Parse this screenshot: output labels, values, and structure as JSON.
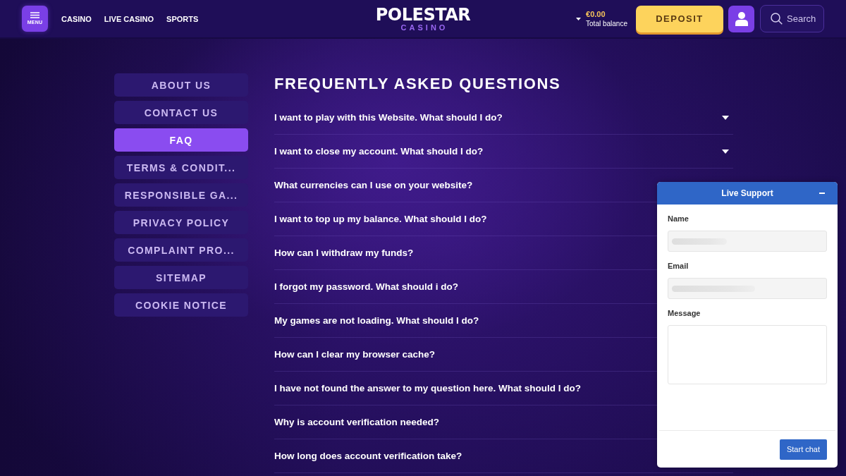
{
  "header": {
    "menu_button": {
      "label": "MENU"
    },
    "nav": [
      "CASINO",
      "LIVE CASINO",
      "SPORTS"
    ],
    "logo": {
      "title": "POLESTAR",
      "subtitle": "CASINO"
    },
    "balance": {
      "amount": "€0.00",
      "label": "Total balance"
    },
    "deposit_button": "DEPOSIT",
    "search": {
      "placeholder": "Search"
    }
  },
  "sidebar": {
    "items": [
      {
        "label": "ABOUT US",
        "selected": false
      },
      {
        "label": "CONTACT US",
        "selected": false
      },
      {
        "label": "FAQ",
        "selected": true
      },
      {
        "label": "TERMS & CONDIT...",
        "selected": false
      },
      {
        "label": "RESPONSIBLE GA...",
        "selected": false
      },
      {
        "label": "PRIVACY POLICY",
        "selected": false
      },
      {
        "label": "COMPLAINT PRO...",
        "selected": false
      },
      {
        "label": "SITEMAP",
        "selected": false
      },
      {
        "label": "COOKIE NOTICE",
        "selected": false
      }
    ]
  },
  "faq": {
    "title": "FREQUENTLY ASKED QUESTIONS",
    "items": [
      {
        "question": "I want to play with this Website. What should I do?",
        "expanded": false
      },
      {
        "question": "I want to close my account. What should I do?",
        "expanded": false
      },
      {
        "question": "What currencies can I use on your website?"
      },
      {
        "question": "I want to top up my balance. What should I do?"
      },
      {
        "question": "How can I withdraw my funds?"
      },
      {
        "question": "I forgot my password. What should i do?"
      },
      {
        "question": "My games are not loading. What should I do?"
      },
      {
        "question": "How can I clear my browser cache?"
      },
      {
        "question": "I have not found the answer to my question here. What should I do?"
      },
      {
        "question": "Why is account verification needed?"
      },
      {
        "question": "How long does account verification take?"
      }
    ]
  },
  "chat": {
    "title": "Live Support",
    "fields": [
      {
        "label": "Name",
        "kind": "input",
        "blurred": true
      },
      {
        "label": "Email",
        "kind": "input",
        "blurred": true
      },
      {
        "label": "Message",
        "kind": "textarea"
      }
    ],
    "button": "Start chat"
  }
}
